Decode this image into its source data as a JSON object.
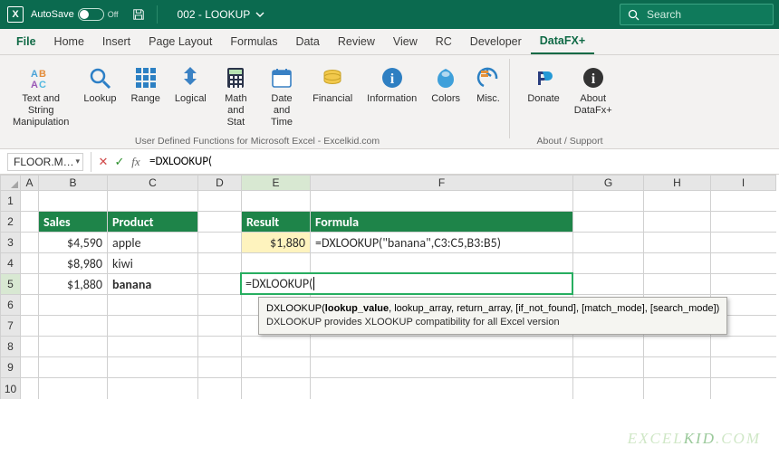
{
  "titlebar": {
    "autosave_label": "AutoSave",
    "autosave_state": "Off",
    "doc_name": "002 - LOOKUP",
    "search_placeholder": "Search"
  },
  "tabs": [
    "File",
    "Home",
    "Insert",
    "Page Layout",
    "Formulas",
    "Data",
    "Review",
    "View",
    "RC",
    "Developer",
    "DataFX+"
  ],
  "active_tab": "DataFX+",
  "ribbon": {
    "group1_label": "User Defined Functions for Microsoft Excel - Excelkid.com",
    "group2_label": "About / Support",
    "chunks": [
      {
        "label": "Text and String\nManipulation",
        "icon": "text-icon"
      },
      {
        "label": "Lookup",
        "icon": "lookup-icon"
      },
      {
        "label": "Range",
        "icon": "range-icon"
      },
      {
        "label": "Logical",
        "icon": "logical-icon"
      },
      {
        "label": "Math\nand Stat",
        "icon": "math-icon"
      },
      {
        "label": "Date and\nTime",
        "icon": "date-icon"
      },
      {
        "label": "Financial",
        "icon": "financial-icon"
      },
      {
        "label": "Information",
        "icon": "info-icon"
      },
      {
        "label": "Colors",
        "icon": "colors-icon"
      },
      {
        "label": "Misc.",
        "icon": "misc-icon"
      }
    ],
    "chunks2": [
      {
        "label": "Donate",
        "icon": "donate-icon"
      },
      {
        "label": "About\nDataFx+",
        "icon": "about-icon"
      }
    ]
  },
  "formula_bar": {
    "namebox": "FLOOR.M…",
    "formula": "=DXLOOKUP("
  },
  "grid": {
    "columns": [
      "A",
      "B",
      "C",
      "D",
      "E",
      "F",
      "G",
      "H",
      "I"
    ],
    "rows": 10,
    "headers": {
      "B2": "Sales",
      "C2": "Product",
      "E2": "Result",
      "F2": "Formula"
    },
    "data": {
      "B3": "$4,590",
      "C3": "apple",
      "B4": "$8,980",
      "C4": "kiwi",
      "B5": "$1,880",
      "C5": "banana",
      "E3": "$1,880",
      "F3": "=DXLOOKUP(\"banana\",C3:C5,B3:B5)"
    },
    "editing": "=DXLOOKUP(",
    "active_col": "E",
    "active_row": 5
  },
  "tooltip": {
    "sig": "DXLOOKUP(",
    "arg1": "lookup_value",
    "rest": ", lookup_array, return_array, [if_not_found], [match_mode], [search_mode])",
    "desc": "DXLOOKUP provides XLOOKUP compatibility for all Excel version"
  },
  "watermark": "EXCELKID.COM"
}
